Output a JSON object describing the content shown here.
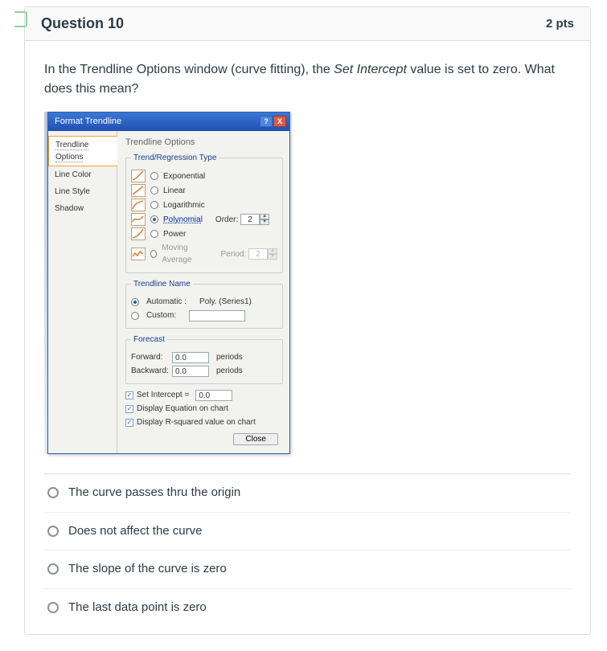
{
  "question": {
    "title": "Question 10",
    "points": "2 pts",
    "text_pre": "In the Trendline Options window (curve fitting), the ",
    "text_em": "Set Intercept",
    "text_post": " value is set to zero. What does this mean?"
  },
  "dialog": {
    "title": "Format Trendline",
    "sidebar": {
      "items": [
        {
          "label": "Trendline Options",
          "active": true
        },
        {
          "label": "Line Color"
        },
        {
          "label": "Line Style"
        },
        {
          "label": "Shadow"
        }
      ]
    },
    "panel_title": "Trendline Options",
    "type_group": {
      "legend": "Trend/Regression Type",
      "types": {
        "exponential": "Exponential",
        "linear": "Linear",
        "logarithmic": "Logarithmic",
        "polynomial": "Polynomial",
        "power": "Power",
        "moving": "Moving Average"
      },
      "order_label": "Order:",
      "order_value": "2",
      "period_label": "Period:",
      "period_value": "2"
    },
    "name_group": {
      "legend": "Trendline Name",
      "auto_label": "Automatic :",
      "auto_value": "Poly. (Series1)",
      "custom_label": "Custom:"
    },
    "forecast_group": {
      "legend": "Forecast",
      "fwd_label": "Forward:",
      "fwd_value": "0.0",
      "bwd_label": "Backward:",
      "bwd_value": "0.0",
      "periods": "periods"
    },
    "checks": {
      "set_intercept_label": "Set Intercept =",
      "set_intercept_value": "0.0",
      "display_eq": "Display Equation on chart",
      "display_r2": "Display R-squared value on chart"
    },
    "close": "Close"
  },
  "answers": [
    "The curve passes thru the origin",
    "Does not affect the curve",
    "The slope of the curve is zero",
    "The last data point is zero"
  ]
}
